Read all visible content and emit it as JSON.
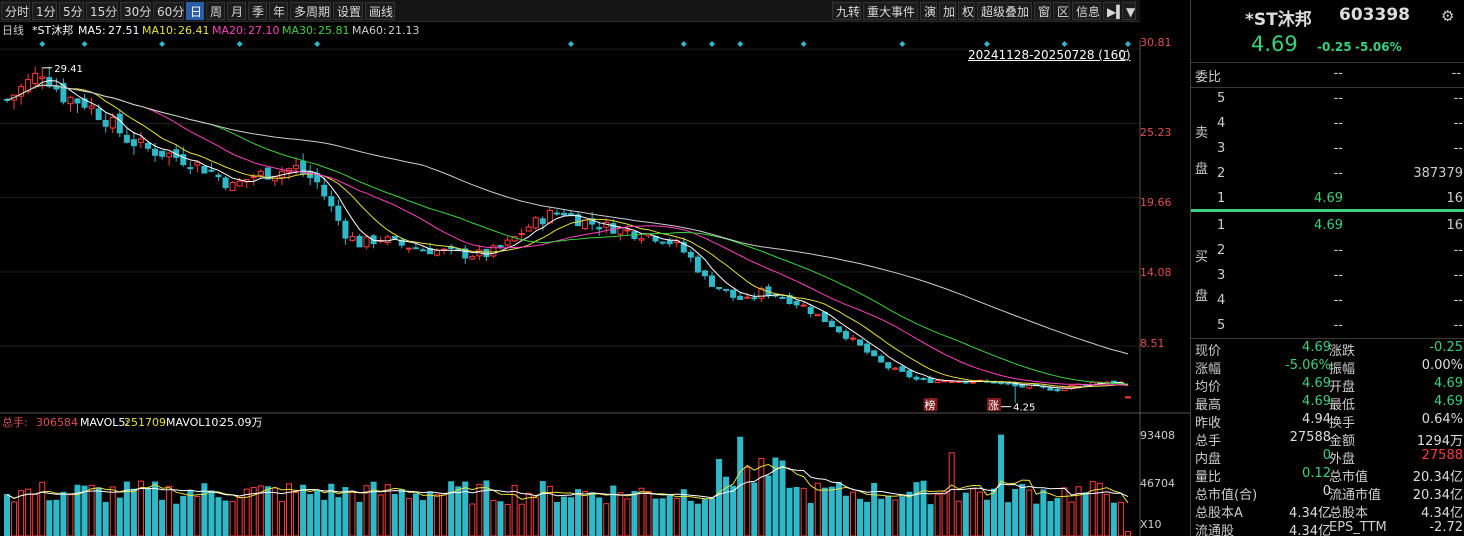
{
  "toolbar": {
    "left_tabs": [
      "分时",
      "1分",
      "5分",
      "15分",
      "30分",
      "60分",
      "日",
      "周",
      "月",
      "季",
      "年",
      "多周期",
      "设置",
      "画线"
    ],
    "active_tab": "日",
    "right_tabs": [
      "九转",
      "重大事件",
      "演",
      "加",
      "权",
      "超级叠加",
      "窗",
      "区",
      "信息",
      "▶▍",
      "▼"
    ]
  },
  "legend": {
    "period": "日线",
    "stock": "*ST沐邦",
    "ma5_label": "MA5:",
    "ma5": "27.51",
    "ma10_label": "MA10:",
    "ma10": "26.41",
    "ma20_label": "MA20:",
    "ma20": "27.10",
    "ma30_label": "MA30:",
    "ma30": "25.81",
    "ma60_label": "MA60:",
    "ma60": "21.13"
  },
  "colors": {
    "up": "#ff3b3b",
    "down": "#2fb8c8",
    "ma5": "#ffffff",
    "ma10": "#e8e040",
    "ma20": "#ff40c0",
    "ma30": "#40d040",
    "ma60": "#cccccc",
    "accent": "#2a5ea8"
  },
  "range_label": "20241128-20250728 (160)",
  "high_mark": "29.41",
  "low_mark": "4.25",
  "tag_bang": "榜",
  "tag_zhang": "涨",
  "price_axis": [
    "30.81",
    "25.23",
    "19.66",
    "14.08",
    "8.51"
  ],
  "vol_axis": [
    "93408",
    "46704",
    "X10"
  ],
  "vol_legend": {
    "total_label": "总手:",
    "total": "306584",
    "mavol5_label": "MAVOL5:",
    "mavol5": "251709",
    "mavol10_label": "MAVOL10:",
    "mavol10": "25.09万"
  },
  "chart_data": {
    "type": "candlestick",
    "count": 160,
    "close_start": 28.5,
    "close_end": 4.69,
    "high": 29.41,
    "low": 4.25,
    "ylim": [
      3.4,
      31.5
    ],
    "vol_ylim": [
      0,
      93408
    ],
    "anchors": [
      [
        0,
        27.0
      ],
      [
        3,
        28.3
      ],
      [
        5,
        29.2
      ],
      [
        8,
        27.3
      ],
      [
        11,
        26.8
      ],
      [
        14,
        25.6
      ],
      [
        17,
        24.1
      ],
      [
        20,
        23.3
      ],
      [
        23,
        22.9
      ],
      [
        26,
        22.4
      ],
      [
        29,
        21.6
      ],
      [
        32,
        20.5
      ],
      [
        35,
        21.3
      ],
      [
        38,
        21.6
      ],
      [
        41,
        21.9
      ],
      [
        44,
        20.8
      ],
      [
        46,
        18.9
      ],
      [
        48,
        17.0
      ],
      [
        50,
        16.2
      ],
      [
        53,
        16.6
      ],
      [
        56,
        16.1
      ],
      [
        59,
        15.8
      ],
      [
        62,
        15.6
      ],
      [
        65,
        15.4
      ],
      [
        68,
        15.4
      ],
      [
        71,
        16.2
      ],
      [
        74,
        17.5
      ],
      [
        77,
        18.4
      ],
      [
        79,
        18.6
      ],
      [
        81,
        18.0
      ],
      [
        84,
        17.6
      ],
      [
        87,
        17.3
      ],
      [
        89,
        17.0
      ],
      [
        91,
        16.9
      ],
      [
        93,
        16.6
      ],
      [
        95,
        16.1
      ],
      [
        97,
        15.1
      ],
      [
        99,
        13.6
      ],
      [
        101,
        12.9
      ],
      [
        103,
        12.2
      ],
      [
        105,
        11.9
      ],
      [
        107,
        12.6
      ],
      [
        109,
        12.4
      ],
      [
        111,
        12.0
      ],
      [
        113,
        11.5
      ],
      [
        115,
        10.8
      ],
      [
        117,
        10.1
      ],
      [
        119,
        9.3
      ],
      [
        121,
        8.5
      ],
      [
        123,
        7.6
      ],
      [
        125,
        6.9
      ],
      [
        127,
        6.5
      ],
      [
        129,
        6.0
      ],
      [
        131,
        5.9
      ],
      [
        134,
        5.95
      ],
      [
        137,
        5.85
      ],
      [
        140,
        5.8
      ],
      [
        143,
        5.5
      ],
      [
        146,
        5.4
      ],
      [
        149,
        5.25
      ],
      [
        152,
        5.6
      ],
      [
        155,
        5.85
      ],
      [
        158,
        5.75
      ],
      [
        159,
        4.69
      ]
    ]
  },
  "right": {
    "name": "*ST沐邦",
    "code": "603398",
    "price": "4.69",
    "change": "-0.25",
    "change_pct": "-5.06%",
    "weibi_label": "委比",
    "weibi_v1": "--",
    "weibi_v2": "--",
    "sell_label_1": "卖",
    "sell_label_2": "盘",
    "buy_label_1": "买",
    "buy_label_2": "盘",
    "sell": [
      {
        "lvl": "5",
        "price": "--",
        "vol": "--"
      },
      {
        "lvl": "4",
        "price": "--",
        "vol": "--"
      },
      {
        "lvl": "3",
        "price": "--",
        "vol": "--"
      },
      {
        "lvl": "2",
        "price": "--",
        "vol": "387379"
      },
      {
        "lvl": "1",
        "price": "4.69",
        "vol": "16"
      }
    ],
    "buy": [
      {
        "lvl": "1",
        "price": "4.69",
        "vol": "16"
      },
      {
        "lvl": "2",
        "price": "--",
        "vol": "--"
      },
      {
        "lvl": "3",
        "price": "--",
        "vol": "--"
      },
      {
        "lvl": "4",
        "price": "--",
        "vol": "--"
      },
      {
        "lvl": "5",
        "price": "--",
        "vol": "--"
      }
    ],
    "stats": [
      {
        "l1": "现价",
        "v1": "4.69",
        "c1": "g",
        "l2": "涨跌",
        "v2": "-0.25",
        "c2": "g"
      },
      {
        "l1": "涨幅",
        "v1": "-5.06%",
        "c1": "g",
        "l2": "振幅",
        "v2": "0.00%",
        "c2": "w"
      },
      {
        "l1": "均价",
        "v1": "4.69",
        "c1": "g",
        "l2": "开盘",
        "v2": "4.69",
        "c2": "g"
      },
      {
        "l1": "最高",
        "v1": "4.69",
        "c1": "g",
        "l2": "最低",
        "v2": "4.69",
        "c2": "g"
      },
      {
        "l1": "昨收",
        "v1": "4.94",
        "c1": "w",
        "l2": "换手",
        "v2": "0.64%",
        "c2": "w"
      },
      {
        "l1": "总手",
        "v1": "27588",
        "c1": "w",
        "l2": "金额",
        "v2": "1294万",
        "c2": "w"
      },
      {
        "l1": "内盘",
        "v1": "0",
        "c1": "g",
        "l2": "外盘",
        "v2": "27588",
        "c2": "r"
      },
      {
        "l1": "量比",
        "v1": "0.12",
        "c1": "g",
        "l2": "总市值",
        "v2": "20.34亿",
        "c2": "w"
      },
      {
        "l1": "总市值(合)",
        "v1": "0",
        "c1": "w",
        "l2": "流通市值",
        "v2": "20.34亿",
        "c2": "w"
      },
      {
        "l1": "总股本A",
        "v1": "4.34亿",
        "c1": "w",
        "l2": "总股本",
        "v2": "4.34亿",
        "c2": "w"
      },
      {
        "l1": "流通股",
        "v1": "4.34亿",
        "c1": "w",
        "l2": "EPS_TTM",
        "v2": "-2.72",
        "c2": "w"
      }
    ]
  }
}
